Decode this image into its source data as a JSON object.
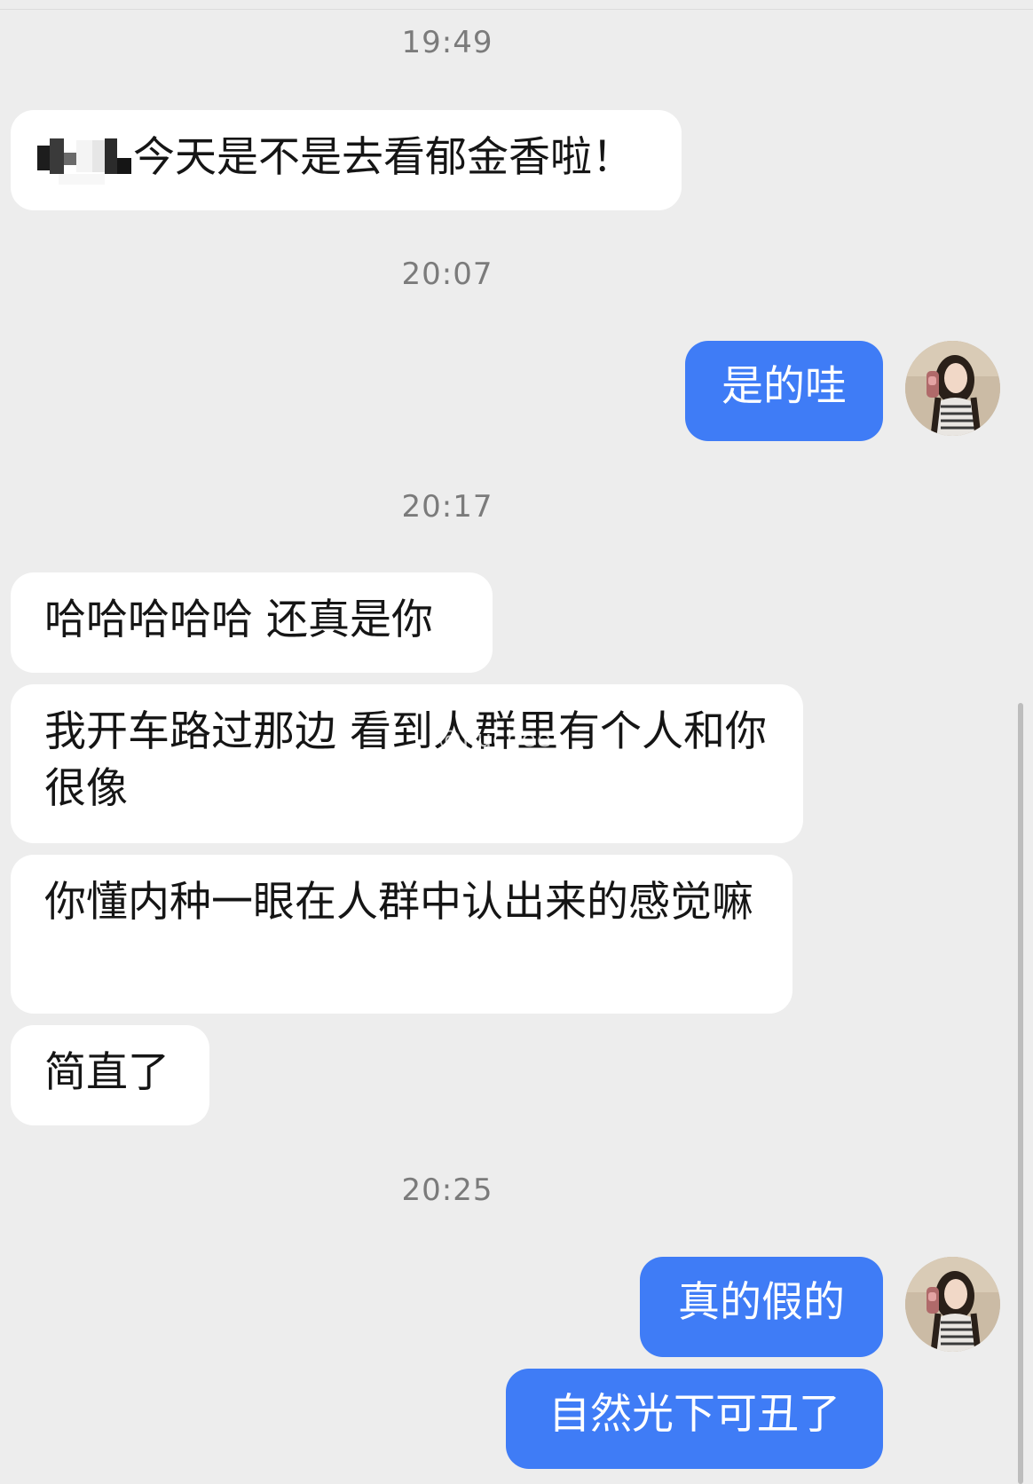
{
  "chat": {
    "time_1": "19:49",
    "msg_1_text": "今天是不是去看郁金香啦！",
    "time_2": "20:07",
    "reply_1": "是的哇",
    "time_3": "20:17",
    "msg_2": "哈哈哈哈哈 还真是你",
    "msg_3": "我开车路过那边 看到人群里有个人和你很像",
    "msg_4": "你懂内种一眼在人群中认出来的感觉嘛",
    "msg_5": "简直了",
    "time_4": "20:25",
    "reply_2": "真的假的",
    "reply_3": "自然光下可丑了"
  },
  "watermark": "@liuchee",
  "colors": {
    "background": "#ededed",
    "incoming_bubble": "#ffffff",
    "outgoing_bubble": "#3f7cf6",
    "timestamp": "#7b7b7b"
  },
  "icons": {
    "avatar": "user-avatar-photo",
    "mosaic": "pixelated-name-redaction"
  }
}
